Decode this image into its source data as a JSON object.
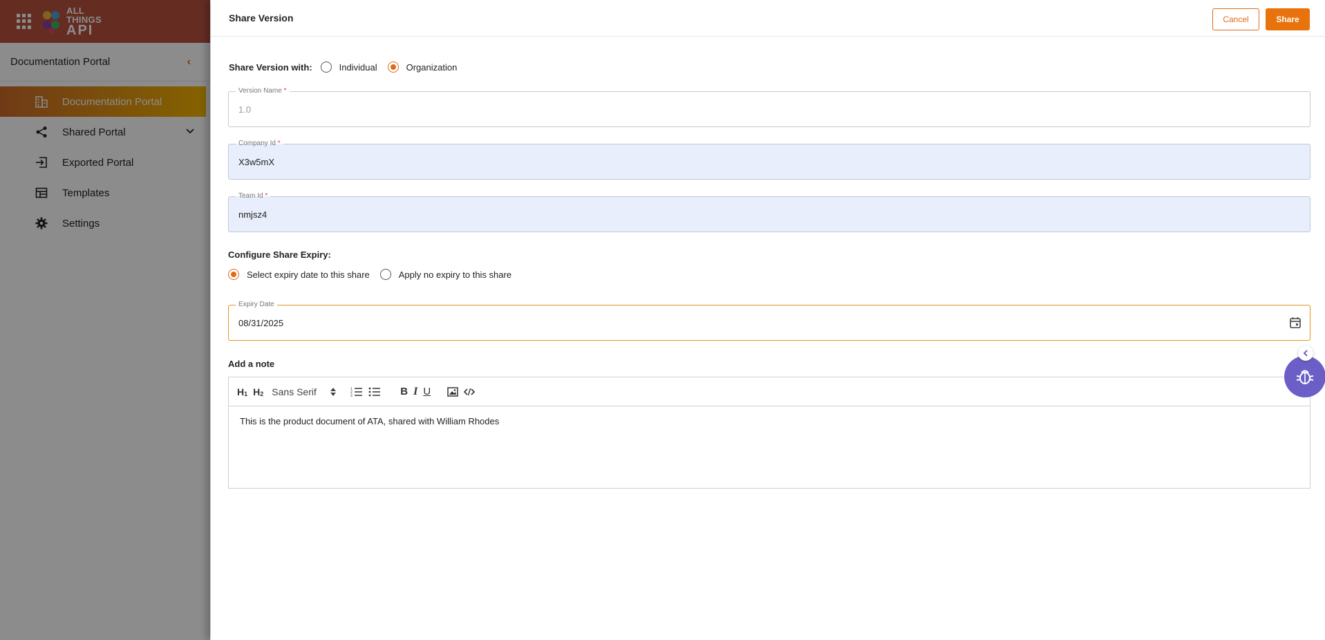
{
  "sidebar": {
    "logo_lines": [
      "ALL",
      "THINGS",
      "API"
    ],
    "title": "Documentation Portal",
    "items": [
      {
        "label": "Documentation Portal",
        "icon": "building-icon",
        "active": true
      },
      {
        "label": "Shared Portal",
        "icon": "share-icon",
        "expandable": true
      },
      {
        "label": "Exported Portal",
        "icon": "export-icon"
      },
      {
        "label": "Templates",
        "icon": "templates-icon"
      },
      {
        "label": "Settings",
        "icon": "gear-icon"
      }
    ]
  },
  "drawer": {
    "title": "Share Version",
    "cancel_label": "Cancel",
    "share_label": "Share",
    "share_with": {
      "label": "Share Version with:",
      "options": [
        "Individual",
        "Organization"
      ],
      "selected": "Organization"
    },
    "fields": {
      "version_name": {
        "label": "Version Name",
        "required": "*",
        "value": "1.0"
      },
      "company_id": {
        "label": "Company Id",
        "required": "*",
        "value": "X3w5mX"
      },
      "team_id": {
        "label": "Team Id",
        "required": "*",
        "value": "nmjsz4"
      },
      "expiry_date": {
        "label": "Expiry Date",
        "value": "08/31/2025"
      }
    },
    "expiry": {
      "label": "Configure Share Expiry:",
      "options": [
        "Select expiry date to this share",
        "Apply no expiry to this share"
      ],
      "selected": "Select expiry date to this share"
    },
    "note": {
      "label": "Add a note",
      "font": "Sans Serif",
      "text": "This is the product document of ATA, shared with William Rhodes"
    }
  },
  "colors": {
    "accent": "#e8720c",
    "sidebar_header": "#b9503e",
    "filled_field": "#e8eefc",
    "fab": "#6b5fc7"
  }
}
